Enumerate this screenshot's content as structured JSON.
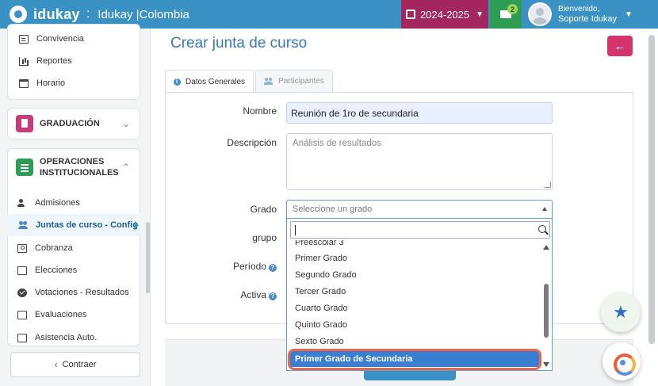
{
  "app": {
    "logo_text": "idukay",
    "separator": ":",
    "org_name": "Idukay |Colombia",
    "year": "2024-2025",
    "mail_badge": "2",
    "user_greeting": "Bienvenido,",
    "user_name": "Soporte Idukay"
  },
  "sidebar": {
    "top_items": [
      {
        "label": "Convivencia",
        "icon": "list-icon"
      },
      {
        "label": "Reportes",
        "icon": "bar-chart-icon"
      },
      {
        "label": "Horario",
        "icon": "calendar-icon"
      }
    ],
    "sections": [
      {
        "title": "GRADUACIÓN",
        "icon": "document-icon",
        "color": "#c63b7b"
      },
      {
        "title": "OPERACIONES INSTITUCIONALES",
        "icon": "list-icon",
        "color": "#2f9c53"
      }
    ],
    "sub_items": [
      {
        "label": "Admisiones",
        "icon": "user-plus-icon"
      },
      {
        "label": "Juntas de curso - Config",
        "icon": "users-icon",
        "active": true
      },
      {
        "label": "Cobranza",
        "icon": "money-icon"
      },
      {
        "label": "Elecciones",
        "icon": "box-icon"
      },
      {
        "label": "Votaciones - Resultados",
        "icon": "check-circle-icon"
      },
      {
        "label": "Evaluaciones",
        "icon": "clipboard-icon"
      },
      {
        "label": "Asistencia Auto.",
        "icon": "document-icon"
      }
    ],
    "collapse_label": "Contraer"
  },
  "main": {
    "title": "Crear junta de curso",
    "tabs": [
      {
        "label": "Datos Generales",
        "active": true
      },
      {
        "label": "Participantes",
        "active": false
      }
    ],
    "form": {
      "nombre_label": "Nombre",
      "nombre_value": "Reunión de 1ro de secundaria",
      "descripcion_label": "Descripción",
      "descripcion_value": "Análisis de resultados",
      "grado_label": "Grado",
      "grado_placeholder": "Seleccione un grado",
      "grupo_label": "grupo",
      "periodo_label": "Período",
      "activa_label": "Activa"
    },
    "dropdown": {
      "search_value": "",
      "options": [
        "Preescolar 3",
        "Primer Grado",
        "Segundo Grado",
        "Tercer Grado",
        "Cuarto Grado",
        "Quinto Grado",
        "Sexto Grado",
        "Primer Grado de Secundaria"
      ],
      "highlighted": "Primer Grado de Secundaria"
    }
  },
  "colors": {
    "topbar": "#3a91c4",
    "year_box": "#a3265e",
    "mail_box": "#2f9c53",
    "back_button": "#d6336c",
    "highlight": "#3b7dd1",
    "highlight_ring": "#e8684a"
  }
}
